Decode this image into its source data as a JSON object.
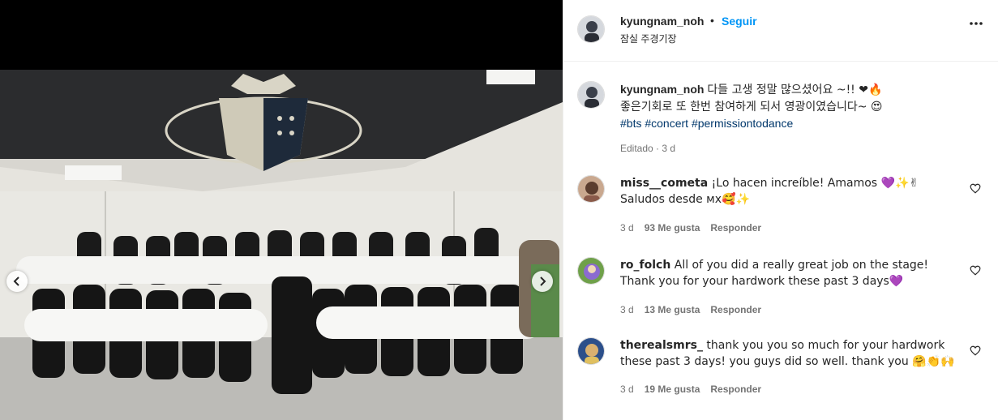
{
  "post": {
    "author": "kyungnam_noh",
    "dot": "•",
    "follow_label": "Seguir",
    "location": "잠실 주경기장",
    "caption_text": "다들 고생 정말 많으셨어요 ~!! ❤🔥",
    "caption_line2": "좋은기회로 또 한번 참여하게 되서 영광이였습니다~ 😍",
    "hashtags": "#bts #concert #permissiontodance",
    "edited_label": "Editado · 3 d"
  },
  "comments": [
    {
      "user": "miss__cometa",
      "text": "¡Lo hacen increíble! Amamos 💜✨✌ Saludos desde ᴍx🥰✨",
      "age": "3 d",
      "likes": "93 Me gusta",
      "reply": "Responder"
    },
    {
      "user": "ro_folch",
      "text": "All of you did a really great job on the stage! Thank you for your hardwork these past 3 days💜",
      "age": "3 d",
      "likes": "13 Me gusta",
      "reply": "Responder"
    },
    {
      "user": "therealsmrs_",
      "text": "thank you you so much for your hardwork these past 3 days! you guys did so well. thank you 🤗👏🙌",
      "age": "3 d",
      "likes": "19 Me gusta",
      "reply": "Responder"
    }
  ],
  "colors": {
    "accent": "#0095f6",
    "hashtag": "#00376b",
    "meta": "#737373"
  },
  "icons": {
    "more": "more-options-icon",
    "like": "heart-icon",
    "prev": "chevron-left-icon",
    "next": "chevron-right-icon"
  }
}
